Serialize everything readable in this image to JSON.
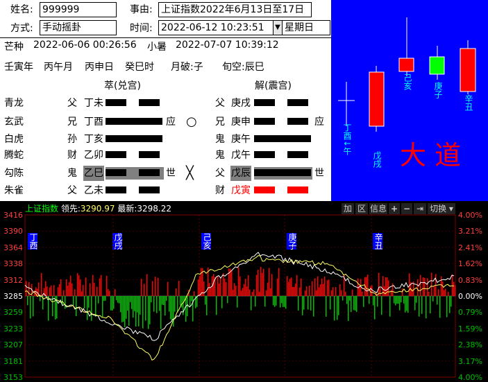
{
  "form": {
    "name_label": "姓名:",
    "name_value": "999999",
    "event_label": "事由:",
    "event_value": "上证指数2022年6月13日至17日",
    "method_label": "方式:",
    "method_value": "手动摇卦",
    "time_label": "时间:",
    "time_value": "2022-06-12 10:23:51",
    "weekday": "星期日"
  },
  "terms": {
    "t1_name": "芒种",
    "t1_time": "2022-06-06 00:26:56",
    "t2_name": "小暑",
    "t2_time": "2022-07-07 10:39:12"
  },
  "ganzhi": [
    "壬寅年",
    "丙午月",
    "丙申日",
    "癸巳时",
    "月破:子",
    "旬空:辰巳"
  ],
  "hexagrams": {
    "left_title": "萃(兑宫)",
    "right_title": "解(震宫)"
  },
  "lines": [
    {
      "god": "青龙",
      "rel": "父",
      "name": "丁未",
      "yang": false,
      "mark": "",
      "change": "",
      "r_rel": "父",
      "r_name": "庚戌",
      "r_yang": false,
      "r_mark": ""
    },
    {
      "god": "玄武",
      "rel": "兄",
      "name": "丁酉",
      "yang": true,
      "mark": "应",
      "change": "○",
      "r_rel": "兄",
      "r_name": "庚申",
      "r_yang": false,
      "r_mark": "应"
    },
    {
      "god": "白虎",
      "rel": "孙",
      "name": "丁亥",
      "yang": true,
      "mark": "",
      "change": "",
      "r_rel": "鬼",
      "r_name": "庚午",
      "r_yang": true,
      "r_mark": ""
    },
    {
      "god": "腾蛇",
      "rel": "财",
      "name": "乙卯",
      "yang": false,
      "mark": "",
      "change": "",
      "r_rel": "鬼",
      "r_name": "戊午",
      "r_yang": false,
      "r_mark": ""
    },
    {
      "god": "勾陈",
      "rel": "鬼",
      "name": "乙巳",
      "yang": false,
      "mark": "世",
      "change": "╳",
      "r_rel": "父",
      "r_name": "戊辰",
      "r_yang": true,
      "r_mark": "世"
    },
    {
      "god": "朱雀",
      "rel": "父",
      "name": "乙未",
      "yang": false,
      "mark": "",
      "change": "",
      "r_rel": "财",
      "r_name": "戊寅",
      "r_yang": false,
      "r_mark": ""
    }
  ],
  "candles": {
    "labels": [
      "丁酉↓午",
      "戊戌",
      "己亥",
      "庚子",
      "辛丑"
    ],
    "big_text": "大 道"
  },
  "toolbar": {
    "index_name": "上证指数",
    "lead_label": "领先:",
    "lead_value": "3290.97",
    "latest_label": "最新:",
    "latest_value": "3298.22",
    "btn_add": "加",
    "btn_zone": "区",
    "btn_info": "信息",
    "btn_switch": "切换"
  },
  "axis": {
    "left": [
      "3416",
      "3390",
      "3364",
      "3338",
      "3312",
      "3285",
      "3259",
      "3233",
      "3207",
      "3181",
      "3153"
    ],
    "right": [
      "4.00%",
      "3.21%",
      "2.41%",
      "1.62%",
      "0.83%",
      "0.00%",
      "0.79%",
      "1.59%",
      "2.38%",
      "3.17%",
      "4.00%"
    ]
  },
  "day_markers": [
    "丁酉",
    "戊戌",
    "己亥",
    "庚子",
    "辛丑"
  ],
  "colors": {
    "up": "#ff0000",
    "down": "#00c000",
    "accent": "#00ffff",
    "bg_chart": "#000000",
    "panel": "#0000ff"
  }
}
